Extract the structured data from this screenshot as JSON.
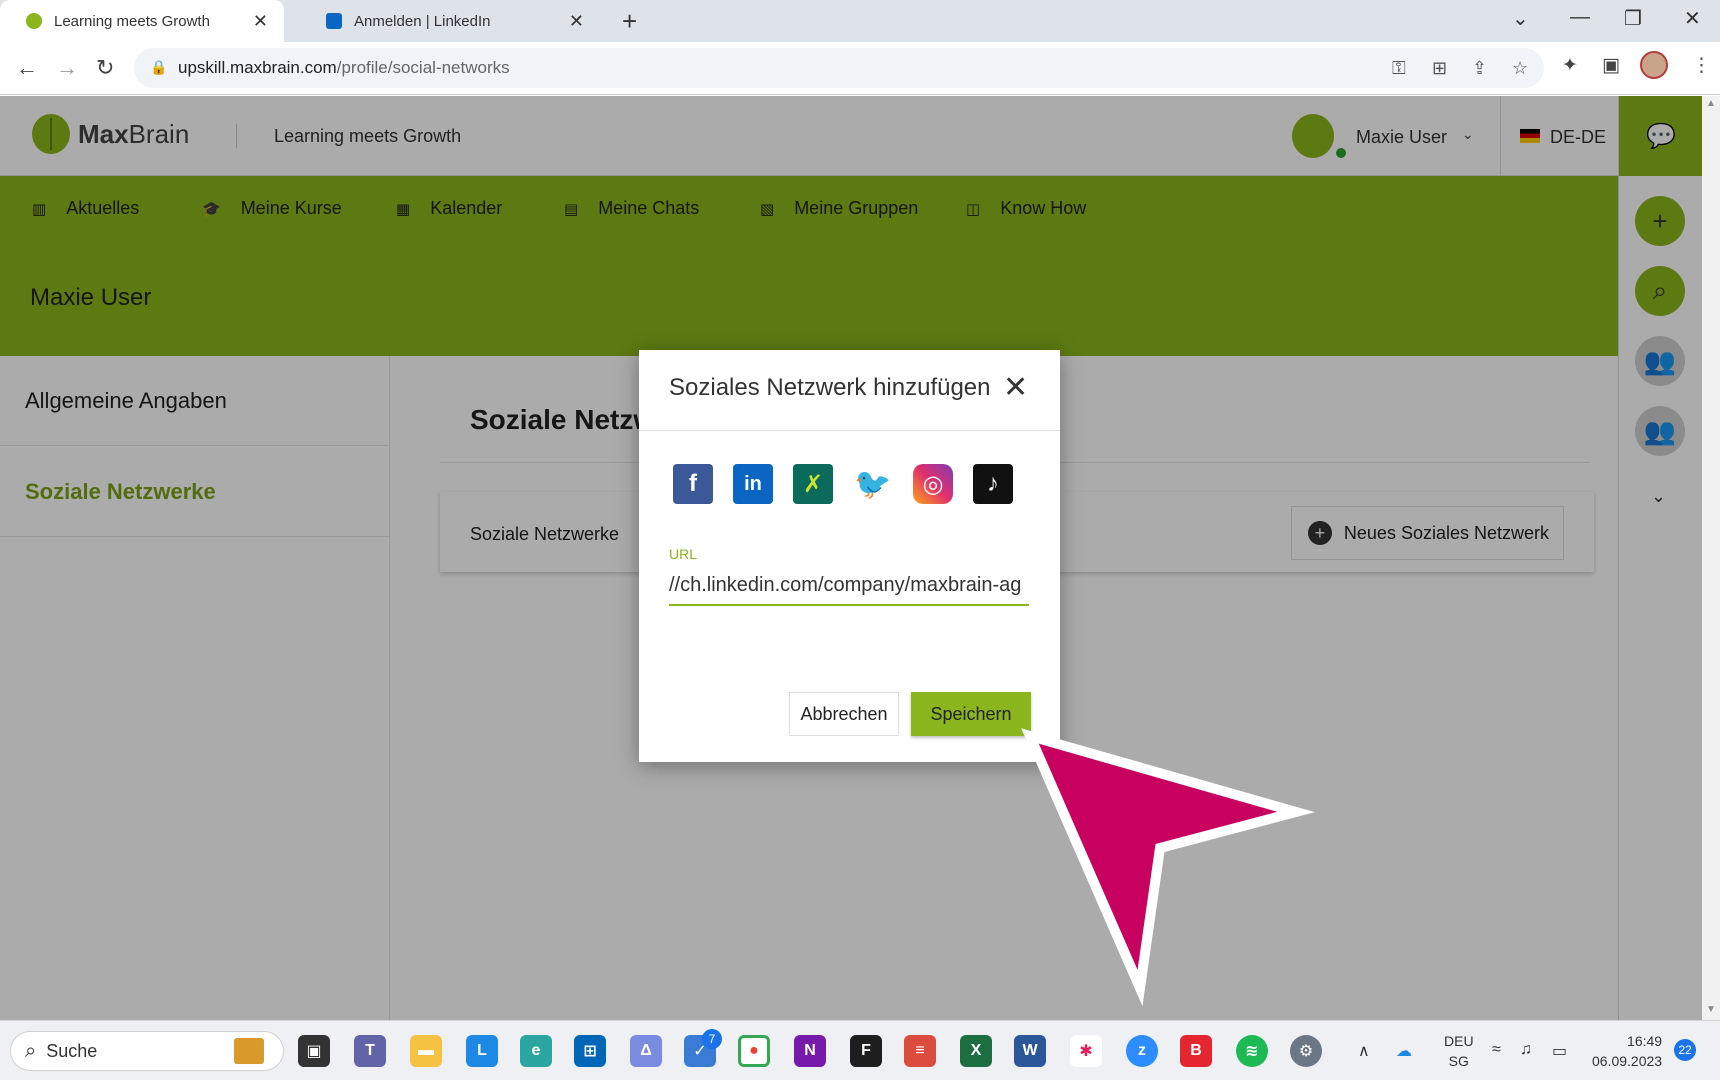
{
  "browser": {
    "tabs": [
      {
        "title": "Learning meets Growth",
        "active": true
      },
      {
        "title": "Anmelden | LinkedIn",
        "active": false
      }
    ],
    "url_host": "upskill.maxbrain.com",
    "url_path": "/profile/social-networks"
  },
  "header": {
    "logo_bold": "Max",
    "logo_light": "Brain",
    "tagline": "Learning meets Growth",
    "user_name": "Maxie User",
    "language": "DE-DE"
  },
  "nav": [
    {
      "label": "Aktuelles",
      "icon": "library-icon"
    },
    {
      "label": "Meine Kurse",
      "icon": "graduation-cap-icon"
    },
    {
      "label": "Kalender",
      "icon": "calendar-icon"
    },
    {
      "label": "Meine Chats",
      "icon": "inbox-icon"
    },
    {
      "label": "Meine Gruppen",
      "icon": "group-card-icon"
    },
    {
      "label": "Know How",
      "icon": "book-icon"
    }
  ],
  "profile": {
    "title": "Maxie User"
  },
  "left_menu": [
    {
      "label": "Allgemeine Angaben",
      "active": false
    },
    {
      "label": "Soziale Netzwerke",
      "active": true
    }
  ],
  "main": {
    "section_title": "Soziale Netzwerke",
    "card_label": "Soziale Netzwerke",
    "new_button": "Neues Soziales Netzwerk"
  },
  "modal": {
    "title": "Soziales Netzwerk hinzufügen",
    "networks": [
      "Facebook",
      "LinkedIn",
      "XING",
      "Twitter",
      "Instagram",
      "TikTok"
    ],
    "url_label": "URL",
    "url_value": "//ch.linkedin.com/company/maxbrain-ag",
    "cancel_label": "Abbrechen",
    "save_label": "Speichern"
  },
  "taskbar": {
    "search_placeholder": "Suche",
    "badge_count": "7",
    "lang_line1": "DEU",
    "lang_line2": "SG",
    "time": "16:49",
    "date": "06.09.2023",
    "notifications": "22"
  },
  "colors": {
    "accent": "#8ab51c",
    "pointer": "#c8005f"
  }
}
